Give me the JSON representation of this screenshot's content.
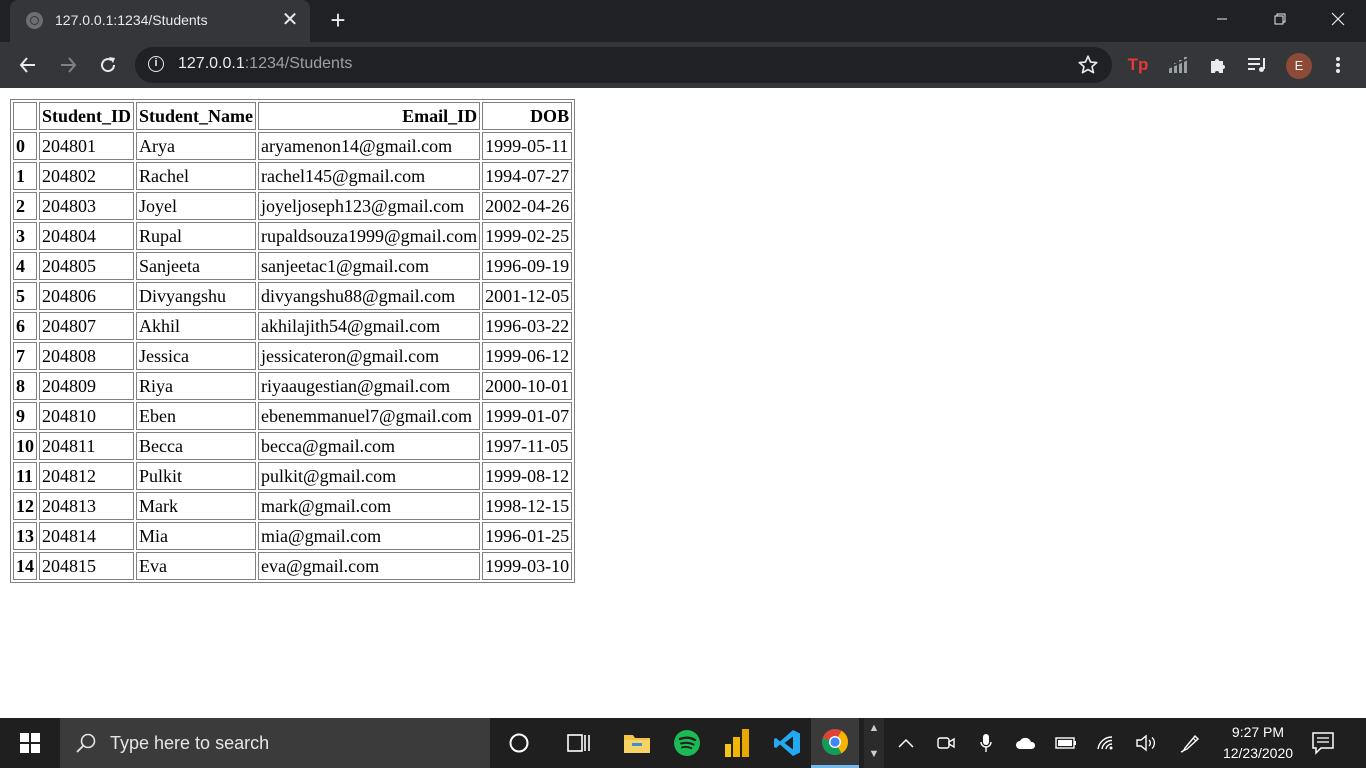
{
  "browser": {
    "tab": {
      "title": "127.0.0.1:1234/Students",
      "close_glyph": "✕",
      "new_tab_glyph": "+"
    },
    "address": {
      "host": "127.0.0.1",
      "port": ":1234",
      "path": "/Students"
    },
    "profile_initial": "E",
    "extensions": {
      "tp_label": "Tp"
    }
  },
  "table": {
    "headers": [
      "",
      "Student_ID",
      "Student_Name",
      "Email_ID",
      "DOB"
    ],
    "rows": [
      {
        "index": "0",
        "student_id": "204801",
        "student_name": "Arya",
        "email_id": "aryamenon14@gmail.com",
        "dob": "1999-05-11"
      },
      {
        "index": "1",
        "student_id": "204802",
        "student_name": "Rachel",
        "email_id": "rachel145@gmail.com",
        "dob": "1994-07-27"
      },
      {
        "index": "2",
        "student_id": "204803",
        "student_name": "Joyel",
        "email_id": "joyeljoseph123@gmail.com",
        "dob": "2002-04-26"
      },
      {
        "index": "3",
        "student_id": "204804",
        "student_name": "Rupal",
        "email_id": "rupaldsouza1999@gmail.com",
        "dob": "1999-02-25"
      },
      {
        "index": "4",
        "student_id": "204805",
        "student_name": "Sanjeeta",
        "email_id": "sanjeetac1@gmail.com",
        "dob": "1996-09-19"
      },
      {
        "index": "5",
        "student_id": "204806",
        "student_name": "Divyangshu",
        "email_id": "divyangshu88@gmail.com",
        "dob": "2001-12-05"
      },
      {
        "index": "6",
        "student_id": "204807",
        "student_name": "Akhil",
        "email_id": "akhilajith54@gmail.com",
        "dob": "1996-03-22"
      },
      {
        "index": "7",
        "student_id": "204808",
        "student_name": "Jessica",
        "email_id": "jessicateron@gmail.com",
        "dob": "1999-06-12"
      },
      {
        "index": "8",
        "student_id": "204809",
        "student_name": "Riya",
        "email_id": "riyaaugestian@gmail.com",
        "dob": "2000-10-01"
      },
      {
        "index": "9",
        "student_id": "204810",
        "student_name": "Eben",
        "email_id": "ebenemmanuel7@gmail.com",
        "dob": "1999-01-07"
      },
      {
        "index": "10",
        "student_id": "204811",
        "student_name": "Becca",
        "email_id": "becca@gmail.com",
        "dob": "1997-11-05"
      },
      {
        "index": "11",
        "student_id": "204812",
        "student_name": "Pulkit",
        "email_id": "pulkit@gmail.com",
        "dob": "1999-08-12"
      },
      {
        "index": "12",
        "student_id": "204813",
        "student_name": "Mark",
        "email_id": "mark@gmail.com",
        "dob": "1998-12-15"
      },
      {
        "index": "13",
        "student_id": "204814",
        "student_name": "Mia",
        "email_id": "mia@gmail.com",
        "dob": "1996-01-25"
      },
      {
        "index": "14",
        "student_id": "204815",
        "student_name": "Eva",
        "email_id": "eva@gmail.com",
        "dob": "1999-03-10"
      }
    ]
  },
  "taskbar": {
    "search_placeholder": "Type here to search",
    "time": "9:27 PM",
    "date": "12/23/2020",
    "apps": [
      "cortana-icon",
      "task-view-icon",
      "file-explorer-icon",
      "spotify-icon",
      "power-bi-icon",
      "vscode-icon",
      "chrome-icon"
    ]
  },
  "colors": {
    "tab_strip": "#202124",
    "toolbar": "#35363a",
    "taskbar": "#1f1f1f",
    "tp_extension": "#e53935",
    "profile": "#8d4a36",
    "spotify": "#1db954",
    "vscode": "#23a9f2"
  }
}
